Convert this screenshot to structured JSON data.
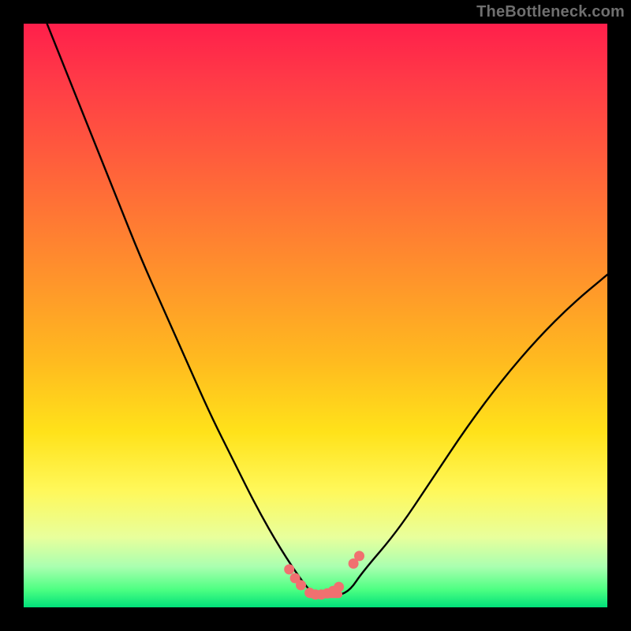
{
  "watermark": "TheBottleneck.com",
  "chart_data": {
    "type": "line",
    "title": "",
    "xlabel": "",
    "ylabel": "",
    "xlim": [
      0,
      1
    ],
    "ylim": [
      0,
      1
    ],
    "series": [
      {
        "name": "bottleneck-curve",
        "x": [
          0.04,
          0.08,
          0.12,
          0.16,
          0.2,
          0.24,
          0.28,
          0.32,
          0.36,
          0.4,
          0.44,
          0.48,
          0.5,
          0.52,
          0.54,
          0.56,
          0.58,
          0.64,
          0.7,
          0.76,
          0.82,
          0.88,
          0.94,
          1.0
        ],
        "y": [
          1.0,
          0.9,
          0.8,
          0.7,
          0.6,
          0.51,
          0.42,
          0.33,
          0.25,
          0.17,
          0.1,
          0.04,
          0.02,
          0.02,
          0.02,
          0.03,
          0.06,
          0.13,
          0.22,
          0.31,
          0.39,
          0.46,
          0.52,
          0.57
        ]
      }
    ],
    "markers": {
      "name": "flat-minimum-markers",
      "color": "#f07070",
      "points": [
        {
          "x": 0.455,
          "y": 0.065
        },
        {
          "x": 0.465,
          "y": 0.05
        },
        {
          "x": 0.475,
          "y": 0.038
        },
        {
          "x": 0.49,
          "y": 0.025
        },
        {
          "x": 0.5,
          "y": 0.022
        },
        {
          "x": 0.51,
          "y": 0.022
        },
        {
          "x": 0.52,
          "y": 0.024
        },
        {
          "x": 0.53,
          "y": 0.028
        },
        {
          "x": 0.54,
          "y": 0.035
        },
        {
          "x": 0.565,
          "y": 0.075
        },
        {
          "x": 0.575,
          "y": 0.088
        }
      ]
    },
    "gradient_stops": [
      {
        "pos": 0.0,
        "color": "#ff1f4b"
      },
      {
        "pos": 0.5,
        "color": "#ffbb1f"
      },
      {
        "pos": 0.8,
        "color": "#fff85a"
      },
      {
        "pos": 0.95,
        "color": "#4cff82"
      },
      {
        "pos": 1.0,
        "color": "#00e07a"
      }
    ]
  }
}
